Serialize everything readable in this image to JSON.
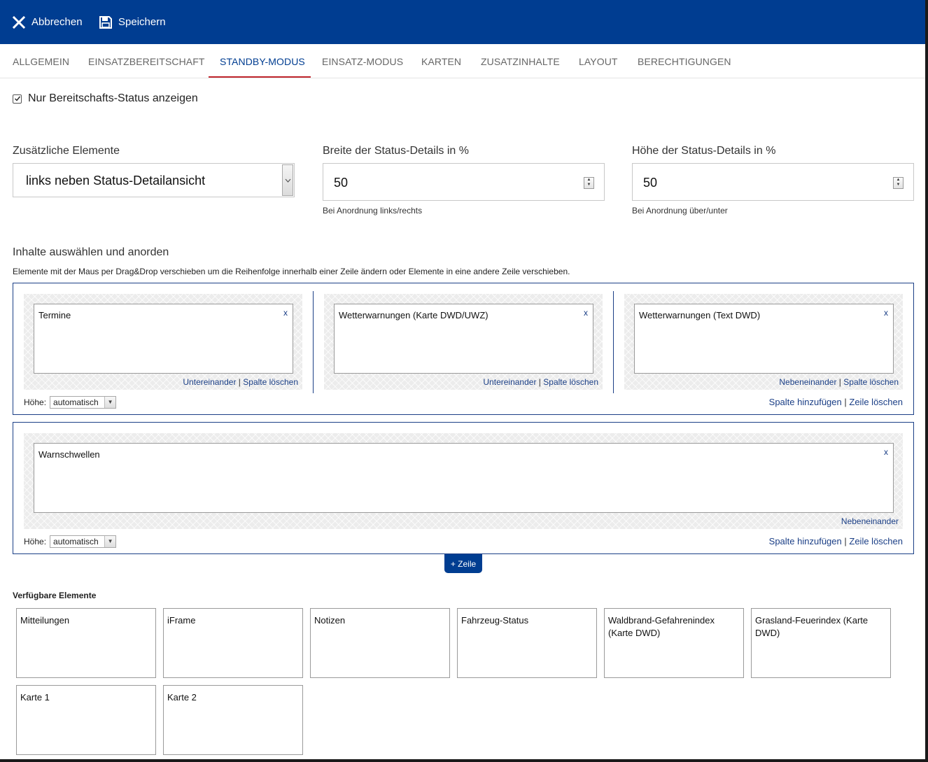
{
  "toolbar": {
    "cancel_label": "Abbrechen",
    "save_label": "Speichern",
    "cancel_icon": "close-icon",
    "save_icon": "floppy-disk-icon"
  },
  "tabs": [
    {
      "label": "ALLGEMEIN"
    },
    {
      "label": "EINSATZBEREITSCHAFT"
    },
    {
      "label": "STANDBY-MODUS",
      "active": true
    },
    {
      "label": "EINSATZ-MODUS"
    },
    {
      "label": "KARTEN"
    },
    {
      "label": "ZUSATZINHALTE"
    },
    {
      "label": "LAYOUT"
    },
    {
      "label": "BERECHTIGUNGEN"
    }
  ],
  "standby_only": {
    "label": "Nur Bereitschafts-Status anzeigen",
    "checked": true
  },
  "fields": {
    "extra_elements": {
      "label": "Zusätzliche Elemente",
      "value": "links neben Status-Detailansicht"
    },
    "width": {
      "label": "Breite der Status-Details in %",
      "value": "50",
      "hint": "Bei Anordnung links/rechts"
    },
    "height": {
      "label": "Höhe der Status-Details in %",
      "value": "50",
      "hint": "Bei Anordnung über/unter"
    }
  },
  "content": {
    "title": "Inhalte auswählen und anorden",
    "description": "Elemente mit der Maus per Drag&Drop verschieben um die Reihenfolge innerhalb einer Zeile ändern oder Elemente in eine andere Zeile verschieben.",
    "close_x": "x",
    "separator": "|",
    "height_label": "Höhe:",
    "add_column": "Spalte hinzufügen",
    "delete_row": "Zeile löschen",
    "delete_column": "Spalte löschen",
    "rows": [
      {
        "height_value": "automatisch",
        "columns": [
          {
            "element": "Termine",
            "layout_link": "Untereinander"
          },
          {
            "element": "Wetterwarnungen (Karte DWD/UWZ)",
            "layout_link": "Untereinander"
          },
          {
            "element": "Wetterwarnungen (Text DWD)",
            "layout_link": "Nebeneinander"
          }
        ]
      },
      {
        "height_value": "automatisch",
        "columns": [
          {
            "element": "Warnschwellen",
            "layout_link": "Nebeneinander"
          }
        ]
      }
    ],
    "add_row_label": "+ Zeile"
  },
  "available": {
    "title": "Verfügbare Elemente",
    "items": [
      "Mitteilungen",
      "iFrame",
      "Notizen",
      "Fahrzeug-Status",
      "Waldbrand-Gefahrenindex (Karte DWD)",
      "Grasland-Feuerindex (Karte DWD)",
      "Karte 1",
      "Karte 2"
    ]
  },
  "colors": {
    "brand": "#003d91",
    "active_tab_underline": "#c0262d",
    "link": "#1b3f86"
  }
}
